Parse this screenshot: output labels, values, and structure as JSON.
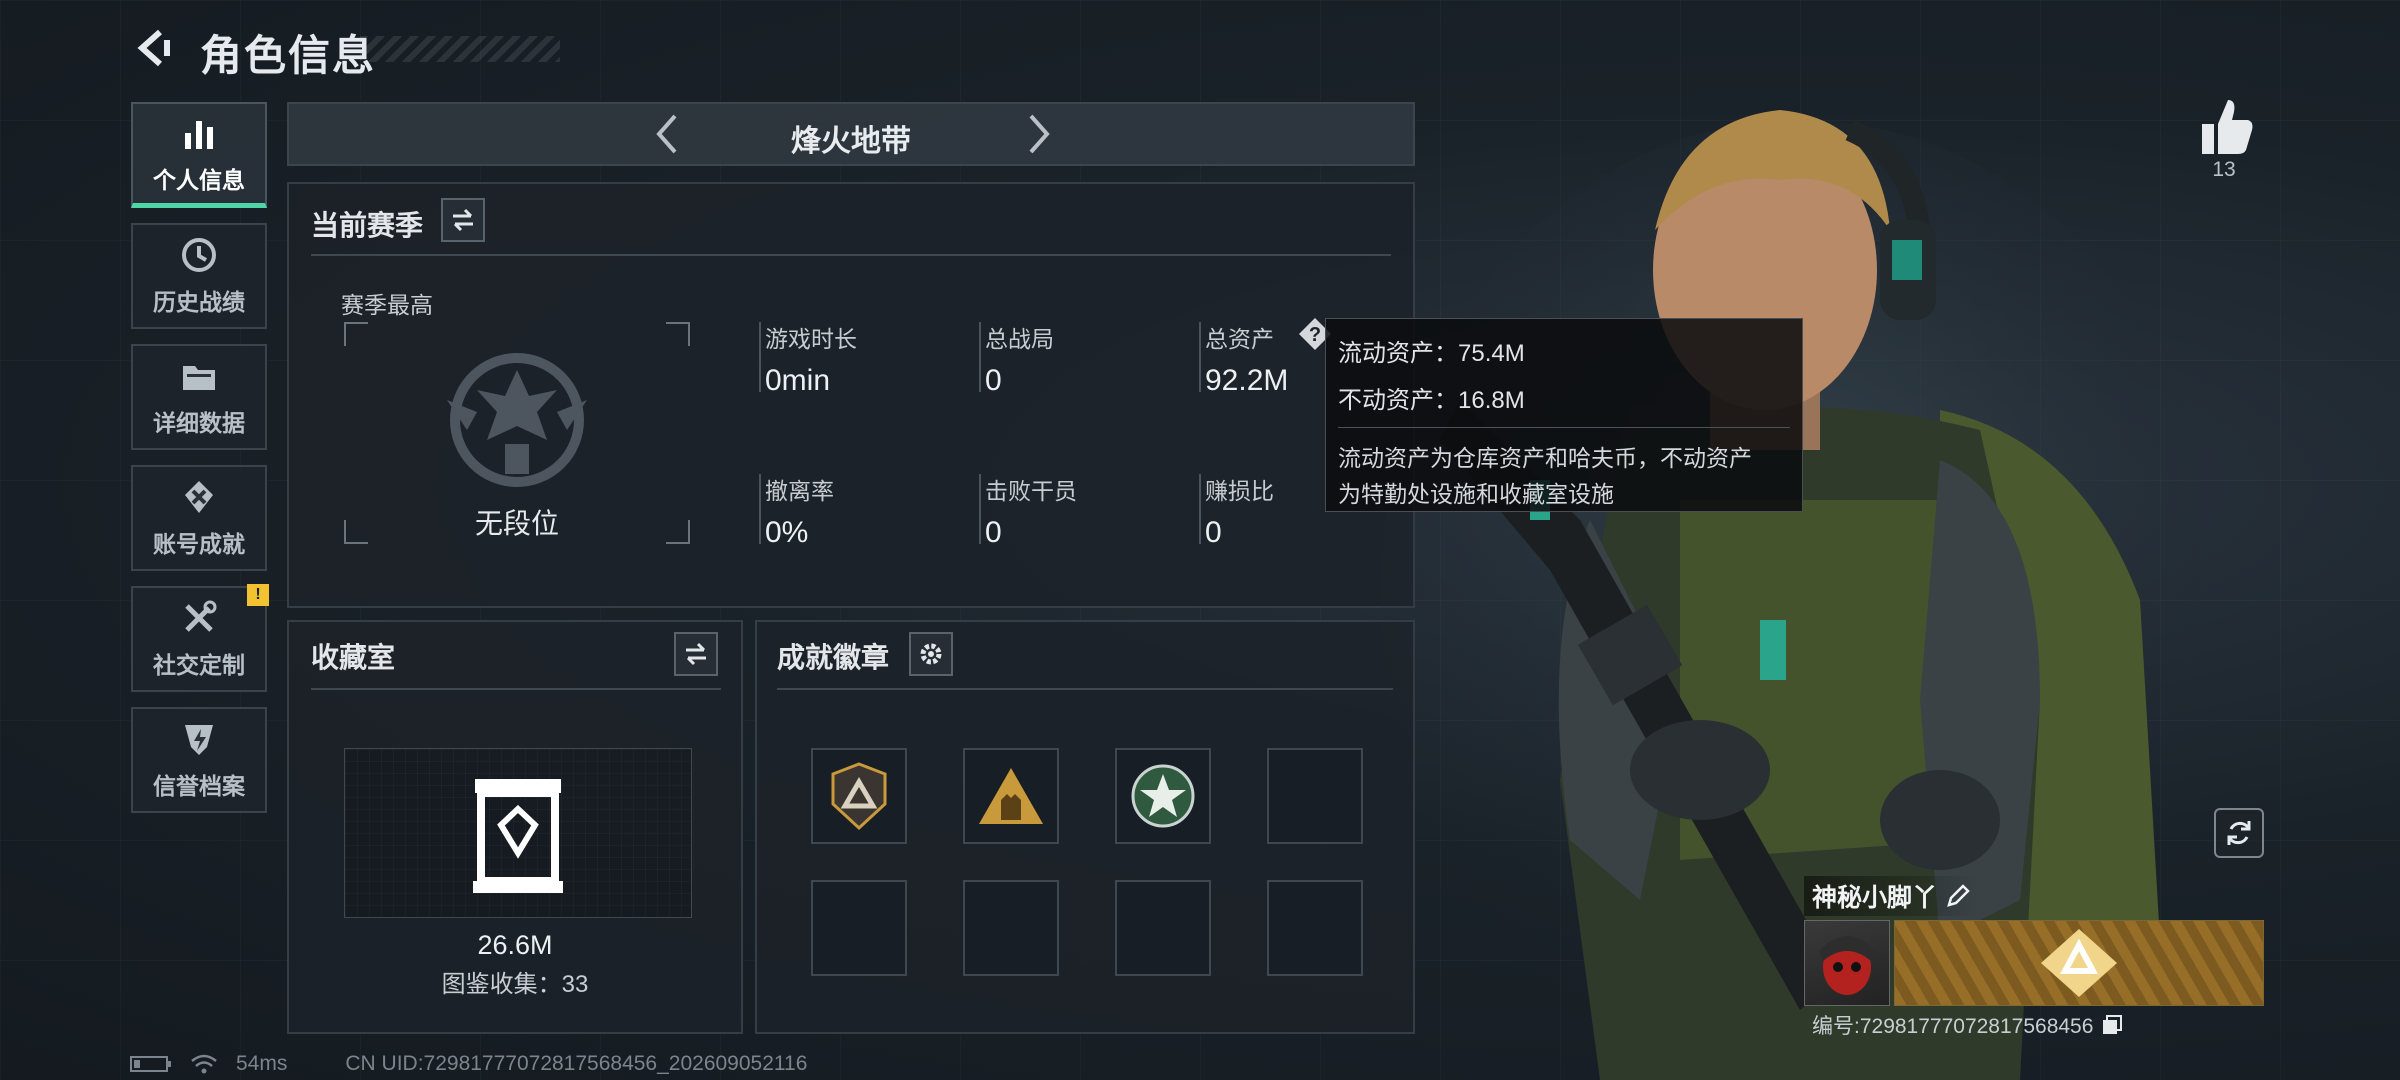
{
  "header": {
    "title": "角色信息"
  },
  "nav": {
    "items": [
      {
        "label": "个人信息",
        "icon": "bar-chart-icon",
        "active": true
      },
      {
        "label": "历史战绩",
        "icon": "history-clock-icon"
      },
      {
        "label": "详细数据",
        "icon": "folder-icon"
      },
      {
        "label": "账号成就",
        "icon": "achievement-icon"
      },
      {
        "label": "社交定制",
        "icon": "tools-icon",
        "badge": "!"
      },
      {
        "label": "信誉档案",
        "icon": "shield-bolt-icon"
      }
    ]
  },
  "mode": {
    "title": "烽火地带"
  },
  "season": {
    "title": "当前赛季",
    "best_label": "赛季最高",
    "rank": "无段位",
    "stats": [
      {
        "label": "游戏时长",
        "value": "0min"
      },
      {
        "label": "总战局",
        "value": "0"
      },
      {
        "label": "总资产",
        "value": "92.2M"
      },
      {
        "label": "撤离率",
        "value": "0%"
      },
      {
        "label": "击败干员",
        "value": "0"
      },
      {
        "label": "赚损比",
        "value": "0"
      }
    ]
  },
  "tooltip": {
    "liquid": "流动资产：75.4M",
    "fixed": "不动资产：16.8M",
    "desc_line1": "流动资产为仓库资产和哈夫币，不动资产",
    "desc_line2": "为特勤处设施和收藏室设施"
  },
  "collection": {
    "title": "收藏室",
    "value": "26.6M",
    "count": "图鉴收集：33"
  },
  "achievements": {
    "title": "成就徽章"
  },
  "like": {
    "count": "13"
  },
  "player": {
    "name": "神秘小脚丫",
    "id": "编号:7298177707281756845​6"
  },
  "status": {
    "ping": "54ms",
    "uid": "CN UID:72981777072817568456_202609052116"
  },
  "colors": {
    "accent": "#4fd6a6",
    "badge": "#f2c230",
    "gold": "#c89a3c"
  }
}
